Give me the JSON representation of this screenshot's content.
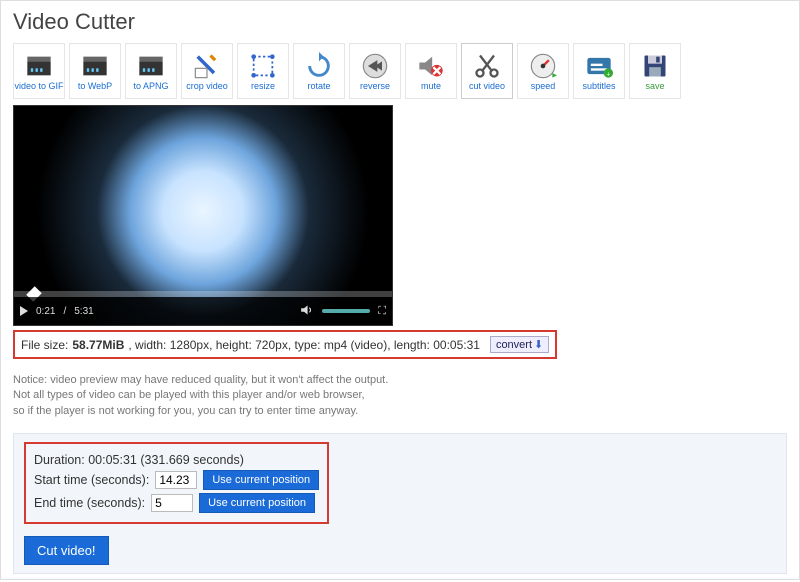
{
  "title": "Video Cutter",
  "toolbar": [
    {
      "name": "video-to-gif",
      "label": "video to GIF"
    },
    {
      "name": "to-webp",
      "label": "to WebP"
    },
    {
      "name": "to-apng",
      "label": "to APNG"
    },
    {
      "name": "crop-video",
      "label": "crop video"
    },
    {
      "name": "resize",
      "label": "resize"
    },
    {
      "name": "rotate",
      "label": "rotate"
    },
    {
      "name": "reverse",
      "label": "reverse"
    },
    {
      "name": "mute",
      "label": "mute"
    },
    {
      "name": "cut-video",
      "label": "cut video",
      "active": true
    },
    {
      "name": "speed",
      "label": "speed"
    },
    {
      "name": "subtitles",
      "label": "subtitles"
    },
    {
      "name": "save",
      "label": "save"
    }
  ],
  "player": {
    "current_time": "0:21",
    "total_time": "5:31",
    "time_separator": " / "
  },
  "info": {
    "size_label": "File size: ",
    "size_value": "58.77MiB",
    "rest": ", width: 1280px, height: 720px, type: mp4 (video), length: 00:05:31",
    "convert_label": "convert"
  },
  "notice": {
    "l1": "Notice: video preview may have reduced quality, but it won't affect the output.",
    "l2": "Not all types of video can be played with this player and/or web browser,",
    "l3": "so if the player is not working for you, you can try to enter time anyway."
  },
  "cut": {
    "duration_label": "Duration: 00:05:31 (331.669 seconds)",
    "start_label": "Start time (seconds):",
    "start_value": "14.23",
    "end_label": "End time (seconds):",
    "end_value": "5",
    "use_pos_label": "Use current position",
    "button_label": "Cut video!"
  }
}
